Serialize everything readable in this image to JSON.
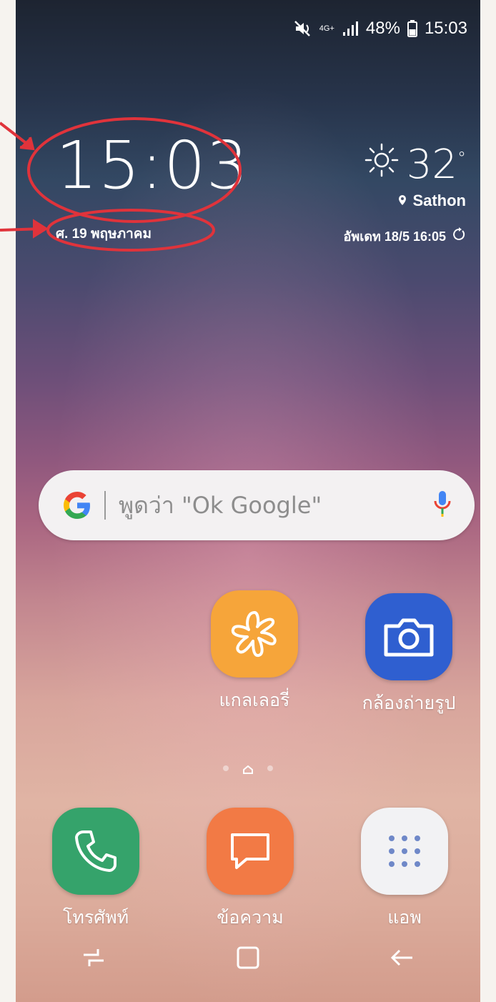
{
  "status_bar": {
    "network_type": "4G+",
    "battery_percent": "48%",
    "time": "15:03",
    "icons": [
      "mute-icon",
      "signal-icon",
      "battery-icon"
    ]
  },
  "lockscreen": {
    "clock": "15:03",
    "date": "ศ. 19 พฤษภาคม"
  },
  "weather": {
    "temperature": "32",
    "degree_symbol": "°",
    "location": "Sathon",
    "updated": "อัพเดท 18/5 16:05",
    "icon": "sun-icon"
  },
  "search": {
    "placeholder": "พูดว่า \"Ok Google\"",
    "icon": "google-g-icon",
    "mic_icon": "microphone-icon"
  },
  "apps": [
    {
      "label": "แกลเลอรี่",
      "icon": "gallery-flower-icon",
      "color": "#f6a53a"
    },
    {
      "label": "กล้องถ่ายรูป",
      "icon": "camera-icon",
      "color": "#2f5fd0"
    }
  ],
  "dock": [
    {
      "label": "โทรศัพท์",
      "icon": "phone-icon",
      "color": "#35a36b"
    },
    {
      "label": "ข้อความ",
      "icon": "message-icon",
      "color": "#f27a45"
    },
    {
      "label": "แอพ",
      "icon": "apps-grid-icon",
      "color": "#f2f2f4"
    }
  ],
  "annotations": {
    "highlight_color": "#e0333b"
  }
}
